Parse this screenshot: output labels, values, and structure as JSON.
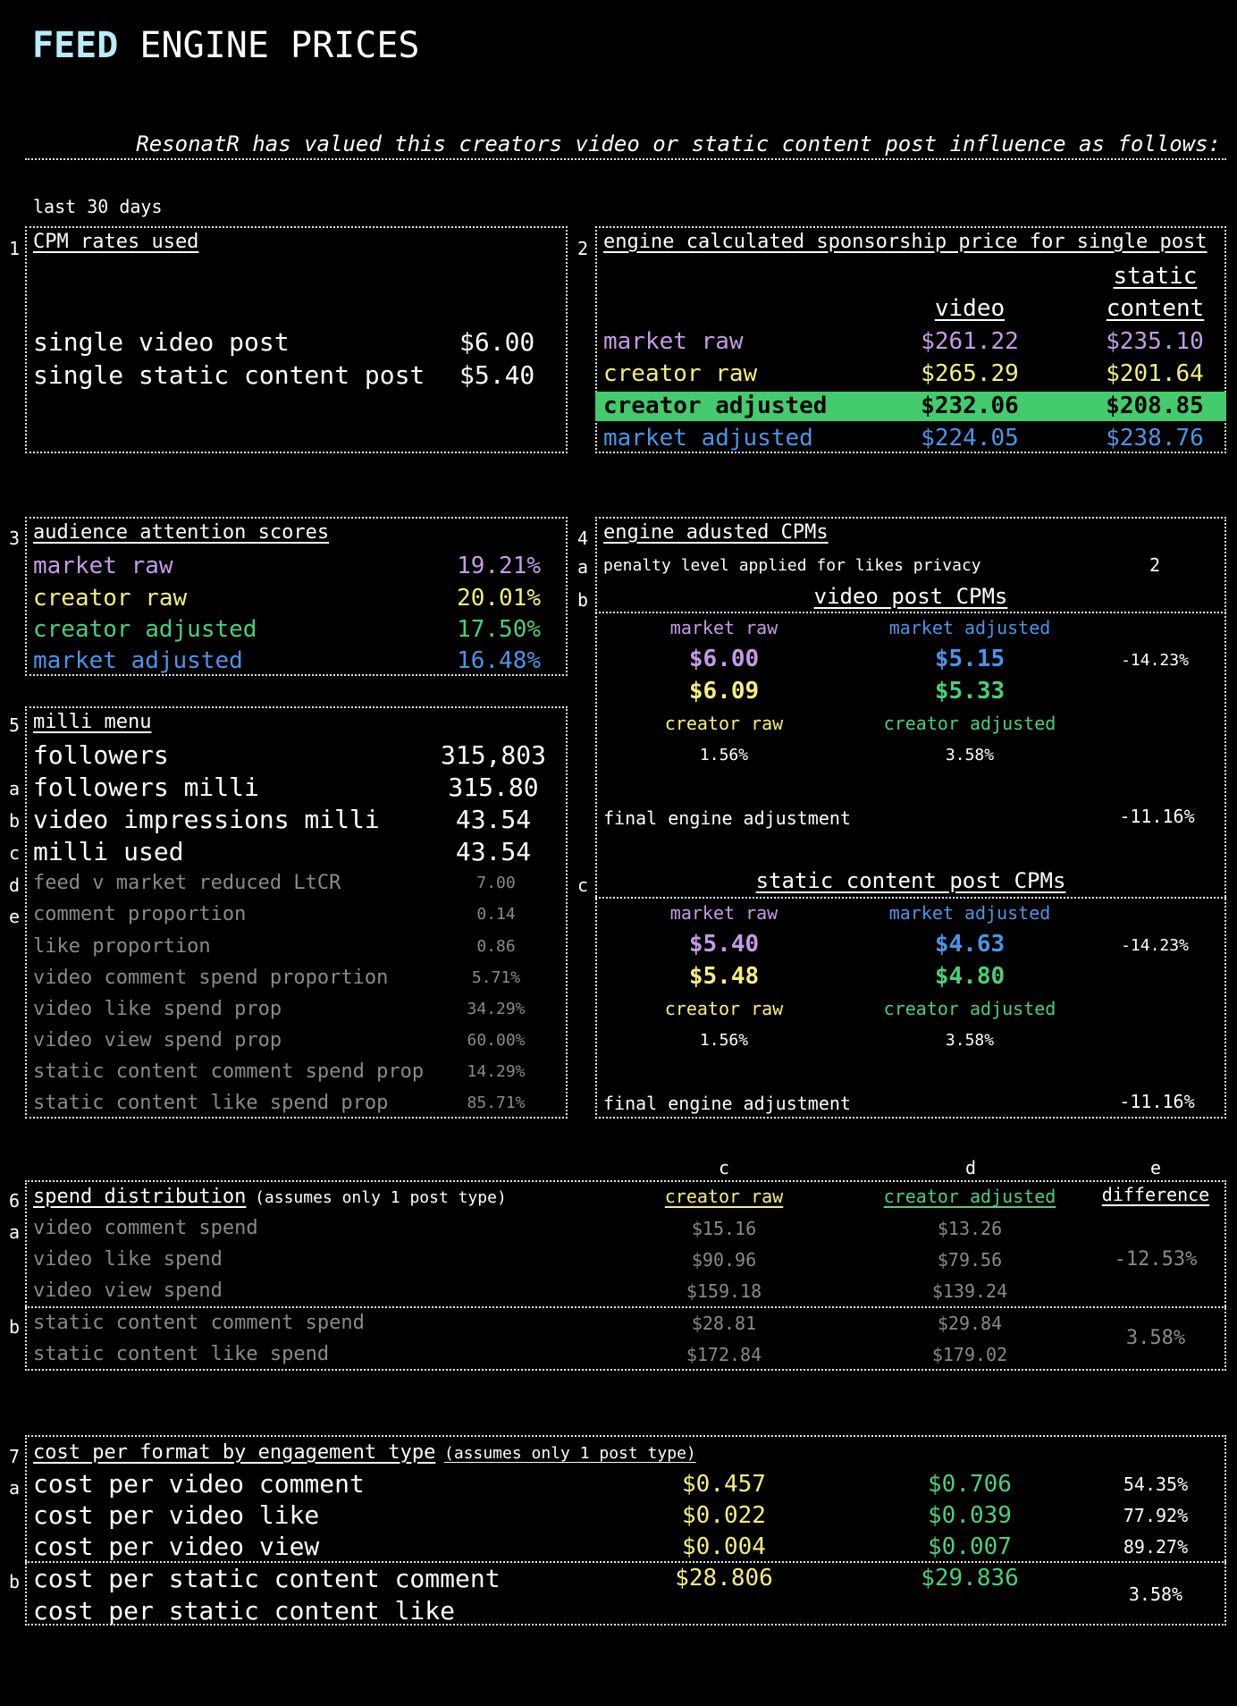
{
  "title": {
    "highlight": "FEED",
    "rest": "ENGINE PRICES"
  },
  "subtitle": "ResonatR has valued this creators video or static content post influence as follows:",
  "period": "last 30 days",
  "section_nums": {
    "s1": "1",
    "s2": "2",
    "s3": "3",
    "s4": "4",
    "s5": "5",
    "s6": "6",
    "s7": "7"
  },
  "letters": {
    "a": "a",
    "b": "b",
    "c": "c",
    "d": "d",
    "e": "e"
  },
  "cpm_rates": {
    "heading": "CPM rates used",
    "video_label": "single video post",
    "video_value": "$6.00",
    "static_label": "single static content post",
    "static_value": "$5.40"
  },
  "sponsorship": {
    "heading": "engine calculated sponsorship price for single post",
    "col_video": "video",
    "col_static_1": "static",
    "col_static_2": "content",
    "rows": [
      {
        "label": "market raw",
        "video": "$261.22",
        "static": "$235.10",
        "color": "#c59be8"
      },
      {
        "label": "creator raw",
        "video": "$265.29",
        "static": "$201.64",
        "color": "#f7ef7c"
      },
      {
        "label": "creator adjusted",
        "video": "$232.06",
        "static": "$208.85",
        "color": "#000000",
        "highlight": "#43cb6d"
      },
      {
        "label": "market adjusted",
        "video": "$224.05",
        "static": "$238.76",
        "color": "#4a95e8"
      }
    ]
  },
  "attention": {
    "heading": "audience attention scores",
    "rows": [
      {
        "label": "market raw",
        "value": "19.21%"
      },
      {
        "label": "creator raw",
        "value": "20.01%"
      },
      {
        "label": "creator adjusted",
        "value": "17.50%"
      },
      {
        "label": "market adjusted",
        "value": "16.48%"
      }
    ]
  },
  "engine_cpms": {
    "heading": "engine adusted CPMs",
    "penalty_label": "penalty level applied for likes privacy",
    "penalty_value": "2",
    "video": {
      "heading": "video post CPMs",
      "market_raw_label": "market raw",
      "market_adjusted_label": "market adjusted",
      "market_raw": "$6.00",
      "market_adjusted": "$5.15",
      "market_diff": "-14.23%",
      "creator_raw": "$6.09",
      "creator_adjusted": "$5.33",
      "creator_raw_label": "creator raw",
      "creator_adjusted_label": "creator adjusted",
      "creator_raw_pct": "1.56%",
      "creator_adjusted_pct": "3.58%",
      "final_label": "final engine  adjustment",
      "final_value": "-11.16%"
    },
    "static": {
      "heading": "static content post CPMs",
      "market_raw_label": "market raw",
      "market_adjusted_label": "market adjusted",
      "market_raw": "$5.40",
      "market_adjusted": "$4.63",
      "market_diff": "-14.23%",
      "creator_raw": "$5.48",
      "creator_adjusted": "$4.80",
      "creator_raw_label": "creator raw",
      "creator_adjusted_label": "creator adjusted",
      "creator_raw_pct": "1.56%",
      "creator_adjusted_pct": "3.58%",
      "final_label": "final engine  adjustment",
      "final_value": "-11.16%"
    }
  },
  "milli": {
    "heading": "milli menu",
    "big_rows": [
      {
        "label": "followers",
        "value": "315,803"
      },
      {
        "label": "followers milli",
        "value": "315.80"
      },
      {
        "label": "video impressions milli",
        "value": "43.54"
      },
      {
        "label": "milli used",
        "value": "43.54"
      }
    ],
    "small_rows": [
      {
        "label": "feed v market reduced LtCR",
        "value": "7.00"
      },
      {
        "label": "comment proportion",
        "value": "0.14"
      },
      {
        "label": "like proportion",
        "value": "0.86"
      },
      {
        "label": "video comment spend proportion",
        "value": "5.71%"
      },
      {
        "label": "video like spend prop",
        "value": "34.29%"
      },
      {
        "label": "video view spend prop",
        "value": "60.00%"
      },
      {
        "label": "static content comment spend prop",
        "value": "14.29%"
      },
      {
        "label": "static content like spend prop",
        "value": "85.71%"
      }
    ]
  },
  "spend": {
    "heading": "spend distribution",
    "note": "(assumes only 1 post type)",
    "col_letters": [
      "c",
      "d",
      "e"
    ],
    "col_creator_raw": "creator raw",
    "col_creator_adjusted": "creator adjusted",
    "col_difference": "difference",
    "video_rows": [
      {
        "label": "video comment spend",
        "raw": "$15.16",
        "adj": "$13.26"
      },
      {
        "label": "video like spend",
        "raw": "$90.96",
        "adj": "$79.56"
      },
      {
        "label": "video view spend",
        "raw": "$159.18",
        "adj": "$139.24"
      }
    ],
    "video_diff": "-12.53%",
    "static_rows": [
      {
        "label": "static content comment spend",
        "raw": "$28.81",
        "adj": "$29.84"
      },
      {
        "label": "static content like spend",
        "raw": "$172.84",
        "adj": "$179.02"
      }
    ],
    "static_diff": "3.58%"
  },
  "cost_format": {
    "heading": "cost per format by engagement type",
    "note": "(assumes only 1 post type)",
    "video_rows": [
      {
        "label": "cost per video comment",
        "raw": "$0.457",
        "adj": "$0.706",
        "diff": "54.35%"
      },
      {
        "label": "cost per video like",
        "raw": "$0.022",
        "adj": "$0.039",
        "diff": "77.92%"
      },
      {
        "label": "cost per video view",
        "raw": "$0.004",
        "adj": "$0.007",
        "diff": "89.27%"
      }
    ],
    "static_label_1": "cost per static content comment",
    "static_label_2": "cost per static content like",
    "static_raw": "$28.806",
    "static_adj": "$29.836",
    "static_diff": "3.58%"
  },
  "colors": {
    "market_raw": "#c59be8",
    "creator_raw": "#f7ef7c",
    "creator_adjusted": "#4ad079",
    "market_adjusted": "#4a95e8",
    "title_accent": "#b8ecfb"
  }
}
